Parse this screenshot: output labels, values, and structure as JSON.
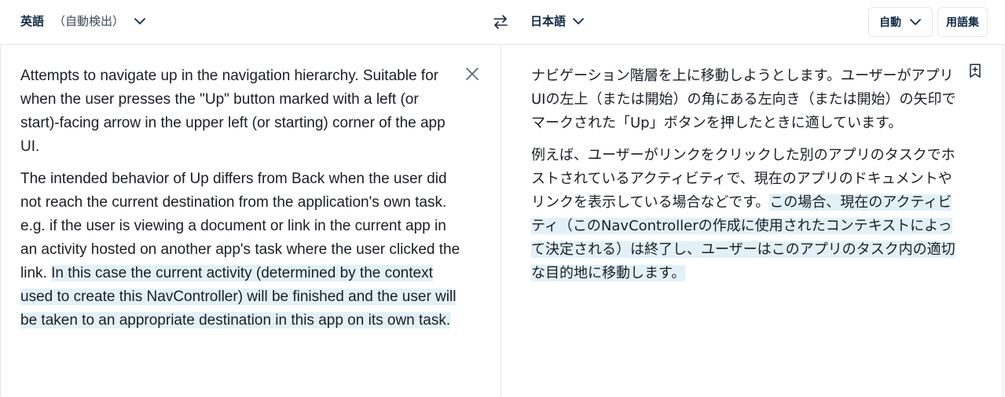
{
  "header": {
    "source_language": "英語",
    "source_detect": "（自動検出）",
    "target_language": "日本語",
    "formality_label": "自動",
    "glossary_label": "用語集"
  },
  "icons": {
    "source_dropdown": "chevron-down-icon",
    "swap": "swap-languages-icon",
    "target_dropdown": "chevron-down-icon",
    "formality_dropdown": "chevron-down-icon",
    "clear": "close-icon",
    "save": "bookmark-add-icon"
  },
  "colors": {
    "highlight": "#e2f1f8",
    "heading_text": "#0f2b46",
    "body_text": "#1b1e25",
    "border": "#e3e6ea"
  },
  "source": {
    "p1": "Attempts to navigate up in the navigation hierarchy. Suitable for when the user presses the \"Up\" button marked with a left (or start)-facing arrow in the upper left (or starting) corner of the app UI.",
    "p2_plain": "The intended behavior of Up differs from Back when the user did not reach the current destination from the application's own task. e.g. if the user is viewing a document or link in the current app in an activity hosted on another app's task where the user clicked the link. ",
    "p2_highlight": "In this case the current activity (determined by the context used to create this NavController) will be finished and the user will be taken to an appropriate destination in this app on its own task."
  },
  "target": {
    "p1": "ナビゲーション階層を上に移動しようとします。ユーザーがアプリUIの左上（または開始）の角にある左向き（または開始）の矢印でマークされた「Up」ボタンを押したときに適しています。",
    "p2_plain": "例えば、ユーザーがリンクをクリックした別のアプリのタスクでホストされているアクティビティで、現在のアプリのドキュメントやリンクを表示している場合などです。",
    "p2_highlight": "この場合、現在のアクティビティ（このNavControllerの作成に使用されたコンテキストによって決定される）は終了し、ユーザーはこのアプリのタスク内の適切な目的地に移動します。"
  }
}
